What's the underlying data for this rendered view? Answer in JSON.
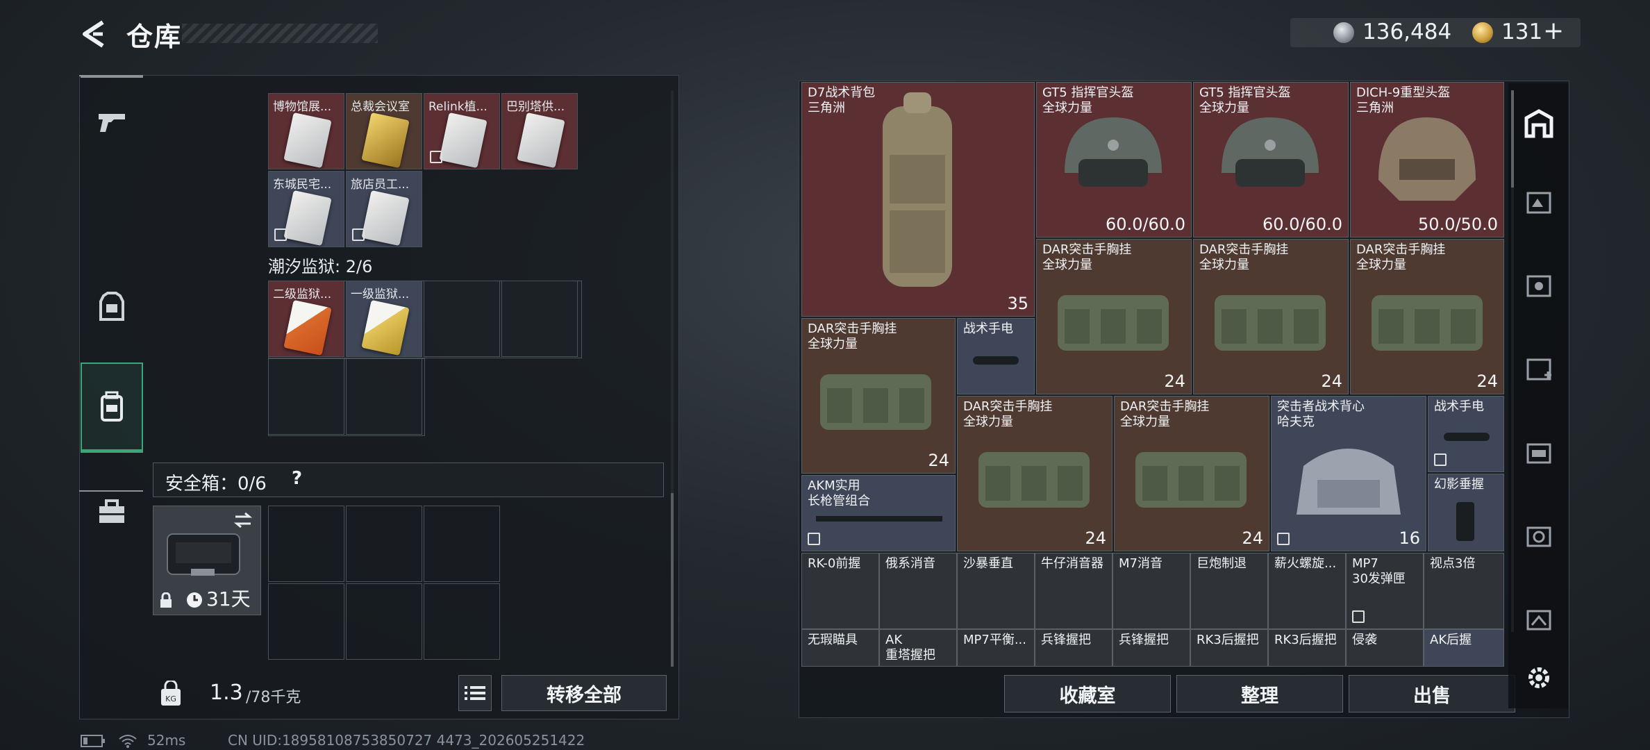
{
  "header": {
    "title": "仓库",
    "silver_amount": "136,484",
    "gold_amount": "131",
    "plus": "+"
  },
  "left": {
    "partial_header": "...",
    "group1_items": [
      {
        "label": "博物馆展..."
      },
      {
        "label": "总裁会议室"
      },
      {
        "label": "Relink植..."
      },
      {
        "label": "巴别塔供..."
      },
      {
        "label": "东城民宅..."
      },
      {
        "label": "旅店员工..."
      }
    ],
    "prison_title": "潮汐监狱: 2/6",
    "group2_items": [
      {
        "label": "二级监狱..."
      },
      {
        "label": "一级监狱..."
      }
    ],
    "safe_label": "安全箱：0/6",
    "safe_help": "?",
    "case_days": "31天",
    "weight": "1.3",
    "weight_max": "/78千克",
    "transfer_all": "转移全部"
  },
  "right": {
    "items": [
      {
        "name": "D7战术背包\n三角洲",
        "value": "35"
      },
      {
        "name": "GT5 指挥官头盔\n全球力量",
        "value": "60.0/60.0"
      },
      {
        "name": "GT5 指挥官头盔\n全球力量",
        "value": "60.0/60.0"
      },
      {
        "name": "DICH-9重型头盔\n三角洲",
        "value": "50.0/50.0"
      },
      {
        "name": "DAR突击手胸挂\n全球力量",
        "value": "24"
      },
      {
        "name": "DAR突击手胸挂\n全球力量",
        "value": "24"
      },
      {
        "name": "DAR突击手胸挂\n全球力量",
        "value": "24"
      },
      {
        "name": "DAR突击手胸挂\n全球力量",
        "value": "24"
      },
      {
        "name": "战术手电",
        "value": ""
      },
      {
        "name": "DAR突击手胸挂\n全球力量",
        "value": "24"
      },
      {
        "name": "DAR突击手胸挂\n全球力量",
        "value": "24"
      },
      {
        "name": "突击者战术背心\n哈夫克",
        "value": "16"
      },
      {
        "name": "战术手电",
        "value": ""
      },
      {
        "name": "AKM实用\n长枪管组合",
        "value": ""
      },
      {
        "name": "幻影垂握",
        "value": ""
      }
    ],
    "small_row1": [
      "RK-0前握",
      "俄系消音",
      "沙暴垂直",
      "牛仔消音器",
      "M7消音",
      "巨炮制退",
      "薪火螺旋...",
      "MP7\n30发弹匣",
      "视点3倍"
    ],
    "small_row2": [
      "无瑕瞄具",
      "AK\n重塔握把",
      "MP7平衡...",
      "兵锋握把",
      "兵锋握把",
      "RK3后握把",
      "RK3后握把",
      "侵袭",
      "AK后握"
    ],
    "btn_collect": "收藏室",
    "btn_sort": "整理",
    "btn_sell": "出售"
  },
  "status": {
    "ping": "52ms",
    "uid": "CN UID:18958108753850727 4473_202605251422"
  },
  "colors": {
    "accent_green": "#3aa67a",
    "red_rarity": "#5c2f33",
    "purple_rarity": "#3e4658"
  }
}
